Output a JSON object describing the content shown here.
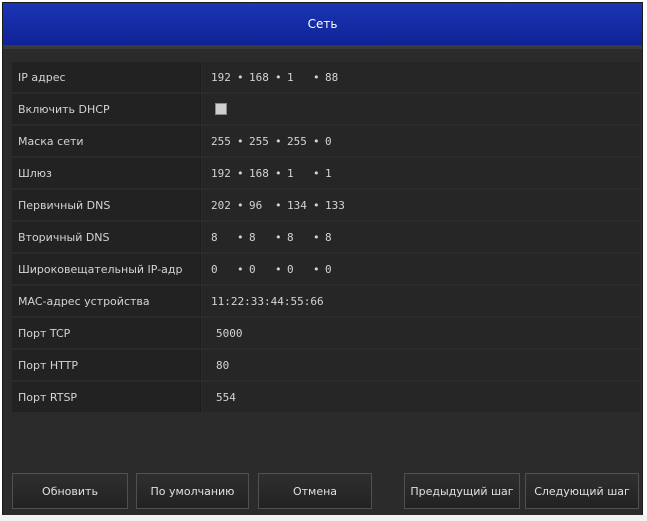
{
  "window": {
    "title": "Сеть"
  },
  "fields": [
    {
      "label": "IP адрес",
      "octets": [
        "192",
        "168",
        "1",
        "88"
      ]
    },
    {
      "label": "Включить DHCP",
      "checked": false
    },
    {
      "label": "Маска сети",
      "octets": [
        "255",
        "255",
        "255",
        "0"
      ]
    },
    {
      "label": "Шлюз",
      "octets": [
        "192",
        "168",
        "1",
        "1"
      ]
    },
    {
      "label": "Первичный DNS",
      "octets": [
        "202",
        "96",
        "134",
        "133"
      ]
    },
    {
      "label": "Вторичный DNS",
      "octets": [
        "8",
        "8",
        "8",
        "8"
      ]
    },
    {
      "label": "Широковещательный IP-адр",
      "octets": [
        "0",
        "0",
        "0",
        "0"
      ]
    },
    {
      "label": "MAC-адрес устройства",
      "value": "11:22:33:44:55:66"
    },
    {
      "label": "Порт TCP",
      "value": "5000"
    },
    {
      "label": "Порт HTTP",
      "value": "80"
    },
    {
      "label": "Порт RTSP",
      "value": "554"
    }
  ],
  "buttons": {
    "refresh": "Обновить",
    "default": "По умолчанию",
    "cancel": "Отмена",
    "prev": "Предыдущий шаг",
    "next": "Следующий шаг"
  }
}
